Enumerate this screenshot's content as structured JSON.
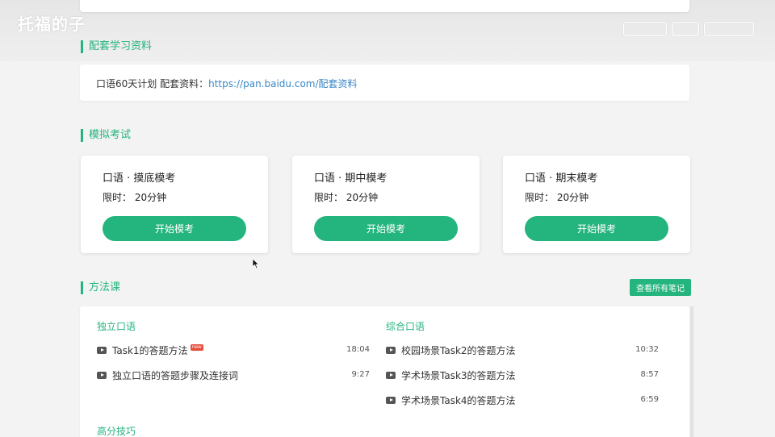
{
  "header": {
    "logo": "托福的子"
  },
  "materials": {
    "section_title": "配套学习资料",
    "text": "口语60天计划 配套资料：",
    "link": "https://pan.baidu.com/配套资料"
  },
  "exams": {
    "section_title": "模拟考试",
    "time_label": "限时：",
    "button_label": "开始模考",
    "cards": [
      {
        "title": "口语 · 摸底模考",
        "time": "20分钟"
      },
      {
        "title": "口语 · 期中模考",
        "time": "20分钟"
      },
      {
        "title": "口语 · 期末模考",
        "time": "20分钟"
      }
    ]
  },
  "courses": {
    "section_title": "方法课",
    "notes_button": "查看所有笔记",
    "columns": [
      {
        "title": "独立口语",
        "lessons": [
          {
            "name": "Task1的答题方法",
            "duration": "18:04",
            "badge": "new"
          },
          {
            "name": "独立口语的答题步骤及连接词",
            "duration": "9:27"
          }
        ]
      },
      {
        "title": "综合口语",
        "lessons": [
          {
            "name": "校园场景Task2的答题方法",
            "duration": "10:32"
          },
          {
            "name": "学术场景Task3的答题方法",
            "duration": "8:57"
          },
          {
            "name": "学术场景Task4的答题方法",
            "duration": "6:59"
          }
        ]
      }
    ],
    "tips_title": "高分技巧"
  },
  "icons": {
    "play": "play-icon",
    "cursor": "cursor-icon"
  },
  "colors": {
    "accent": "#24b47e",
    "link": "#3a87c8",
    "badge": "#e74c3c"
  }
}
